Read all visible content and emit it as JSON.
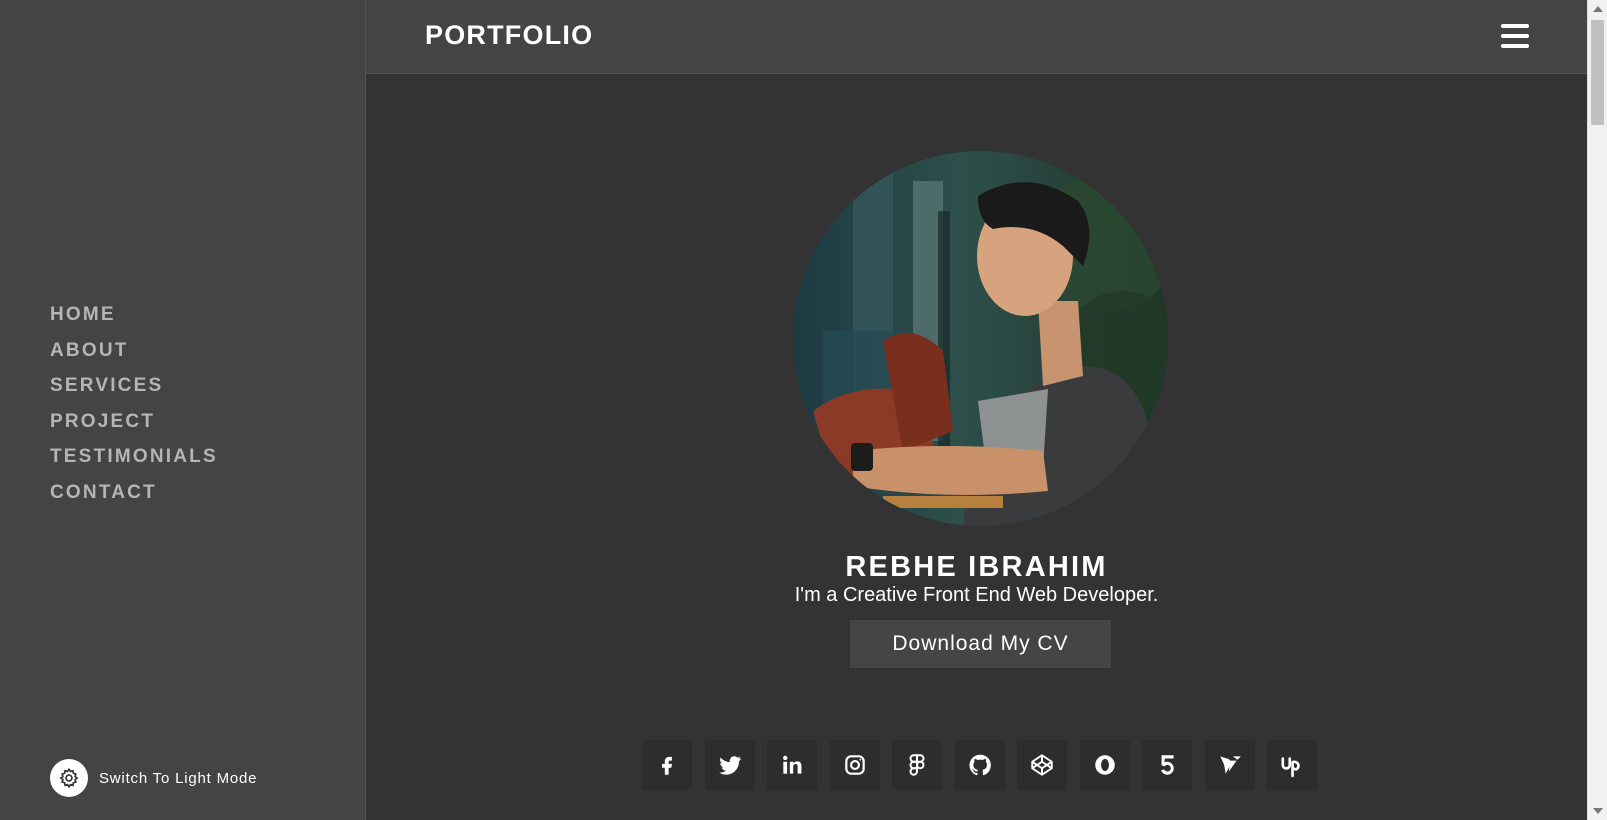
{
  "sidebar": {
    "nav": [
      "HOME",
      "ABOUT",
      "SERVICES",
      "PROJECT",
      "TESTIMONIALS",
      "CONTACT"
    ],
    "theme_toggle": {
      "icon": "gear-icon",
      "label": "Switch To Light Mode"
    }
  },
  "header": {
    "brand": "PORTFOLIO",
    "menu_icon": "hamburger-menu-icon"
  },
  "hero": {
    "avatar": "profile-photo",
    "name": "REBHE IBRAHIM",
    "tagline": "I'm a Creative Front End Web Developer.",
    "cv_button": "Download My CV"
  },
  "socials": [
    {
      "icon": "facebook-icon"
    },
    {
      "icon": "twitter-icon"
    },
    {
      "icon": "linkedin-icon"
    },
    {
      "icon": "instagram-icon"
    },
    {
      "icon": "figma-icon"
    },
    {
      "icon": "github-icon"
    },
    {
      "icon": "codepen-icon"
    },
    {
      "icon": "opera-icon"
    },
    {
      "icon": "five-hundred-px-icon"
    },
    {
      "icon": "freelancer-icon"
    },
    {
      "icon": "upwork-icon"
    }
  ],
  "colors": {
    "background": "#333333",
    "sidebar": "#444444",
    "nav_text": "#b5b5b5",
    "button": "#454545",
    "social_tile": "#2d2d2d"
  }
}
